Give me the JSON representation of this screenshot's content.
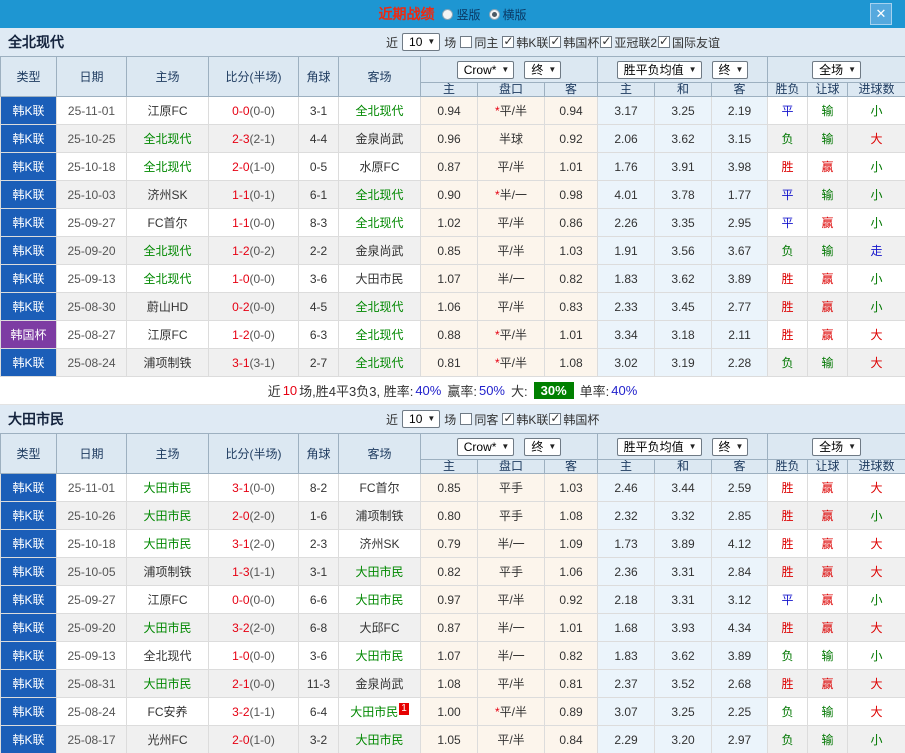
{
  "colors": {
    "topbar_blue": "#1e96d2",
    "title_red": "#ee2a11",
    "score_red": "#e60012",
    "team_green": "#008800",
    "result_blue": "#1414cc",
    "type_blue": "#1b5eb8",
    "type_purple": "#7d3ca3",
    "big_rate_bg": "#008000",
    "odds_cell_bg": "#fcf5ec",
    "avg_cell_bg": "#ebf4fb",
    "section_bar_bg": "#dfeaf4",
    "header_bg": "#dce8f2"
  },
  "topbar": {
    "title": "近期战绩",
    "layout_options": [
      {
        "label": "竖版",
        "selected": false
      },
      {
        "label": "横版",
        "selected": true
      }
    ],
    "close_label": "✕"
  },
  "table_header": {
    "type": "类型",
    "date": "日期",
    "home": "主场",
    "score": "比分(半场)",
    "corner": "角球",
    "away": "客场",
    "odds_select": "Crow*",
    "odds_final_select": "终",
    "avg_select": "胜平负均值",
    "avg_final_select": "终",
    "scope_select": "全场",
    "sub": [
      "主",
      "盘口",
      "客",
      "主",
      "和",
      "客",
      "胜负",
      "让球",
      "进球数"
    ]
  },
  "sections": [
    {
      "team": "全北现代",
      "filters": {
        "near": "近",
        "count": "10",
        "games": "场",
        "same": {
          "label": "同主",
          "checked": false
        },
        "leagues": [
          {
            "label": "韩K联",
            "checked": true
          },
          {
            "label": "韩国杯",
            "checked": true
          },
          {
            "label": "亚冠联2",
            "checked": true
          },
          {
            "label": "国际友谊",
            "checked": true
          }
        ]
      },
      "rows": [
        {
          "type": "韩K联",
          "cup": false,
          "date": "25-11-01",
          "home": "江原FC",
          "homeSelf": false,
          "score": "0-0",
          "half": "(0-0)",
          "corner": "3-1",
          "away": "全北现代",
          "awaySelf": true,
          "badge": "",
          "star": true,
          "homeOdds": "0.94",
          "handicap": "平/半",
          "awayOdds": "0.94",
          "avgWin": "3.17",
          "avgDraw": "3.25",
          "avgLose": "2.19",
          "result": "平",
          "resultColor": "blue",
          "letResult": "输",
          "letColor": "green",
          "goalResult": "小",
          "goalColor": "green"
        },
        {
          "type": "韩K联",
          "cup": false,
          "date": "25-10-25",
          "home": "全北现代",
          "homeSelf": true,
          "score": "2-3",
          "half": "(2-1)",
          "corner": "4-4",
          "away": "金泉尚武",
          "awaySelf": false,
          "badge": "",
          "star": false,
          "homeOdds": "0.96",
          "handicap": "半球",
          "awayOdds": "0.92",
          "avgWin": "2.06",
          "avgDraw": "3.62",
          "avgLose": "3.15",
          "result": "负",
          "resultColor": "green",
          "letResult": "输",
          "letColor": "green",
          "goalResult": "大",
          "goalColor": "red"
        },
        {
          "type": "韩K联",
          "cup": false,
          "date": "25-10-18",
          "home": "全北现代",
          "homeSelf": true,
          "score": "2-0",
          "half": "(1-0)",
          "corner": "0-5",
          "away": "水原FC",
          "awaySelf": false,
          "badge": "",
          "star": false,
          "homeOdds": "0.87",
          "handicap": "平/半",
          "awayOdds": "1.01",
          "avgWin": "1.76",
          "avgDraw": "3.91",
          "avgLose": "3.98",
          "result": "胜",
          "resultColor": "red",
          "letResult": "赢",
          "letColor": "red",
          "goalResult": "小",
          "goalColor": "green"
        },
        {
          "type": "韩K联",
          "cup": false,
          "date": "25-10-03",
          "home": "济州SK",
          "homeSelf": false,
          "score": "1-1",
          "half": "(0-1)",
          "corner": "6-1",
          "away": "全北现代",
          "awaySelf": true,
          "badge": "",
          "star": true,
          "homeOdds": "0.90",
          "handicap": "半/一",
          "awayOdds": "0.98",
          "avgWin": "4.01",
          "avgDraw": "3.78",
          "avgLose": "1.77",
          "result": "平",
          "resultColor": "blue",
          "letResult": "输",
          "letColor": "green",
          "goalResult": "小",
          "goalColor": "green"
        },
        {
          "type": "韩K联",
          "cup": false,
          "date": "25-09-27",
          "home": "FC首尔",
          "homeSelf": false,
          "score": "1-1",
          "half": "(0-0)",
          "corner": "8-3",
          "away": "全北现代",
          "awaySelf": true,
          "badge": "",
          "star": false,
          "homeOdds": "1.02",
          "handicap": "平/半",
          "awayOdds": "0.86",
          "avgWin": "2.26",
          "avgDraw": "3.35",
          "avgLose": "2.95",
          "result": "平",
          "resultColor": "blue",
          "letResult": "赢",
          "letColor": "red",
          "goalResult": "小",
          "goalColor": "green"
        },
        {
          "type": "韩K联",
          "cup": false,
          "date": "25-09-20",
          "home": "全北现代",
          "homeSelf": true,
          "score": "1-2",
          "half": "(0-2)",
          "corner": "2-2",
          "away": "金泉尚武",
          "awaySelf": false,
          "badge": "",
          "star": false,
          "homeOdds": "0.85",
          "handicap": "平/半",
          "awayOdds": "1.03",
          "avgWin": "1.91",
          "avgDraw": "3.56",
          "avgLose": "3.67",
          "result": "负",
          "resultColor": "green",
          "letResult": "输",
          "letColor": "green",
          "goalResult": "走",
          "goalColor": "blue"
        },
        {
          "type": "韩K联",
          "cup": false,
          "date": "25-09-13",
          "home": "全北现代",
          "homeSelf": true,
          "score": "1-0",
          "half": "(0-0)",
          "corner": "3-6",
          "away": "大田市民",
          "awaySelf": false,
          "badge": "",
          "star": false,
          "homeOdds": "1.07",
          "handicap": "半/一",
          "awayOdds": "0.82",
          "avgWin": "1.83",
          "avgDraw": "3.62",
          "avgLose": "3.89",
          "result": "胜",
          "resultColor": "red",
          "letResult": "赢",
          "letColor": "red",
          "goalResult": "小",
          "goalColor": "green"
        },
        {
          "type": "韩K联",
          "cup": false,
          "date": "25-08-30",
          "home": "蔚山HD",
          "homeSelf": false,
          "score": "0-2",
          "half": "(0-0)",
          "corner": "4-5",
          "away": "全北现代",
          "awaySelf": true,
          "badge": "",
          "star": false,
          "homeOdds": "1.06",
          "handicap": "平/半",
          "awayOdds": "0.83",
          "avgWin": "2.33",
          "avgDraw": "3.45",
          "avgLose": "2.77",
          "result": "胜",
          "resultColor": "red",
          "letResult": "赢",
          "letColor": "red",
          "goalResult": "小",
          "goalColor": "green"
        },
        {
          "type": "韩国杯",
          "cup": true,
          "date": "25-08-27",
          "home": "江原FC",
          "homeSelf": false,
          "score": "1-2",
          "half": "(0-0)",
          "corner": "6-3",
          "away": "全北现代",
          "awaySelf": true,
          "badge": "",
          "star": true,
          "homeOdds": "0.88",
          "handicap": "平/半",
          "awayOdds": "1.01",
          "avgWin": "3.34",
          "avgDraw": "3.18",
          "avgLose": "2.11",
          "result": "胜",
          "resultColor": "red",
          "letResult": "赢",
          "letColor": "red",
          "goalResult": "大",
          "goalColor": "red"
        },
        {
          "type": "韩K联",
          "cup": false,
          "date": "25-08-24",
          "home": "浦项制铁",
          "homeSelf": false,
          "score": "3-1",
          "half": "(3-1)",
          "corner": "2-7",
          "away": "全北现代",
          "awaySelf": true,
          "badge": "",
          "star": true,
          "homeOdds": "0.81",
          "handicap": "平/半",
          "awayOdds": "1.08",
          "avgWin": "3.02",
          "avgDraw": "3.19",
          "avgLose": "2.28",
          "result": "负",
          "resultColor": "green",
          "letResult": "输",
          "letColor": "green",
          "goalResult": "大",
          "goalColor": "red"
        }
      ],
      "summary": {
        "prefix": "近",
        "count": "10",
        "seg1": "场,胜4平3负3, 胜率:",
        "rate1": "40%",
        "seg2": "赢率:",
        "rate2": "50%",
        "seg3": "大:",
        "big_rate": "30%",
        "seg4": "单率:",
        "rate3": "40%"
      }
    },
    {
      "team": "大田市民",
      "filters": {
        "near": "近",
        "count": "10",
        "games": "场",
        "same": {
          "label": "同客",
          "checked": false
        },
        "leagues": [
          {
            "label": "韩K联",
            "checked": true
          },
          {
            "label": "韩国杯",
            "checked": true
          }
        ]
      },
      "rows": [
        {
          "type": "韩K联",
          "cup": false,
          "date": "25-11-01",
          "home": "大田市民",
          "homeSelf": true,
          "score": "3-1",
          "half": "(0-0)",
          "corner": "8-2",
          "away": "FC首尔",
          "awaySelf": false,
          "badge": "",
          "star": false,
          "homeOdds": "0.85",
          "handicap": "平手",
          "awayOdds": "1.03",
          "avgWin": "2.46",
          "avgDraw": "3.44",
          "avgLose": "2.59",
          "result": "胜",
          "resultColor": "red",
          "letResult": "赢",
          "letColor": "red",
          "goalResult": "大",
          "goalColor": "red"
        },
        {
          "type": "韩K联",
          "cup": false,
          "date": "25-10-26",
          "home": "大田市民",
          "homeSelf": true,
          "score": "2-0",
          "half": "(2-0)",
          "corner": "1-6",
          "away": "浦项制铁",
          "awaySelf": false,
          "badge": "",
          "star": false,
          "homeOdds": "0.80",
          "handicap": "平手",
          "awayOdds": "1.08",
          "avgWin": "2.32",
          "avgDraw": "3.32",
          "avgLose": "2.85",
          "result": "胜",
          "resultColor": "red",
          "letResult": "赢",
          "letColor": "red",
          "goalResult": "小",
          "goalColor": "green"
        },
        {
          "type": "韩K联",
          "cup": false,
          "date": "25-10-18",
          "home": "大田市民",
          "homeSelf": true,
          "score": "3-1",
          "half": "(2-0)",
          "corner": "2-3",
          "away": "济州SK",
          "awaySelf": false,
          "badge": "",
          "star": false,
          "homeOdds": "0.79",
          "handicap": "半/一",
          "awayOdds": "1.09",
          "avgWin": "1.73",
          "avgDraw": "3.89",
          "avgLose": "4.12",
          "result": "胜",
          "resultColor": "red",
          "letResult": "赢",
          "letColor": "red",
          "goalResult": "大",
          "goalColor": "red"
        },
        {
          "type": "韩K联",
          "cup": false,
          "date": "25-10-05",
          "home": "浦项制铁",
          "homeSelf": false,
          "score": "1-3",
          "half": "(1-1)",
          "corner": "3-1",
          "away": "大田市民",
          "awaySelf": true,
          "badge": "",
          "star": false,
          "homeOdds": "0.82",
          "handicap": "平手",
          "awayOdds": "1.06",
          "avgWin": "2.36",
          "avgDraw": "3.31",
          "avgLose": "2.84",
          "result": "胜",
          "resultColor": "red",
          "letResult": "赢",
          "letColor": "red",
          "goalResult": "大",
          "goalColor": "red"
        },
        {
          "type": "韩K联",
          "cup": false,
          "date": "25-09-27",
          "home": "江原FC",
          "homeSelf": false,
          "score": "0-0",
          "half": "(0-0)",
          "corner": "6-6",
          "away": "大田市民",
          "awaySelf": true,
          "badge": "",
          "star": false,
          "homeOdds": "0.97",
          "handicap": "平/半",
          "awayOdds": "0.92",
          "avgWin": "2.18",
          "avgDraw": "3.31",
          "avgLose": "3.12",
          "result": "平",
          "resultColor": "blue",
          "letResult": "赢",
          "letColor": "red",
          "goalResult": "小",
          "goalColor": "green"
        },
        {
          "type": "韩K联",
          "cup": false,
          "date": "25-09-20",
          "home": "大田市民",
          "homeSelf": true,
          "score": "3-2",
          "half": "(2-0)",
          "corner": "6-8",
          "away": "大邱FC",
          "awaySelf": false,
          "badge": "",
          "star": false,
          "homeOdds": "0.87",
          "handicap": "半/一",
          "awayOdds": "1.01",
          "avgWin": "1.68",
          "avgDraw": "3.93",
          "avgLose": "4.34",
          "result": "胜",
          "resultColor": "red",
          "letResult": "赢",
          "letColor": "red",
          "goalResult": "大",
          "goalColor": "red"
        },
        {
          "type": "韩K联",
          "cup": false,
          "date": "25-09-13",
          "home": "全北现代",
          "homeSelf": false,
          "score": "1-0",
          "half": "(0-0)",
          "corner": "3-6",
          "away": "大田市民",
          "awaySelf": true,
          "badge": "",
          "star": false,
          "homeOdds": "1.07",
          "handicap": "半/一",
          "awayOdds": "0.82",
          "avgWin": "1.83",
          "avgDraw": "3.62",
          "avgLose": "3.89",
          "result": "负",
          "resultColor": "green",
          "letResult": "输",
          "letColor": "green",
          "goalResult": "小",
          "goalColor": "green"
        },
        {
          "type": "韩K联",
          "cup": false,
          "date": "25-08-31",
          "home": "大田市民",
          "homeSelf": true,
          "score": "2-1",
          "half": "(0-0)",
          "corner": "11-3",
          "away": "金泉尚武",
          "awaySelf": false,
          "badge": "",
          "star": false,
          "homeOdds": "1.08",
          "handicap": "平/半",
          "awayOdds": "0.81",
          "avgWin": "2.37",
          "avgDraw": "3.52",
          "avgLose": "2.68",
          "result": "胜",
          "resultColor": "red",
          "letResult": "赢",
          "letColor": "red",
          "goalResult": "大",
          "goalColor": "red"
        },
        {
          "type": "韩K联",
          "cup": false,
          "date": "25-08-24",
          "home": "FC安养",
          "homeSelf": false,
          "score": "3-2",
          "half": "(1-1)",
          "corner": "6-4",
          "away": "大田市民",
          "awaySelf": true,
          "badge": "1",
          "star": true,
          "homeOdds": "1.00",
          "handicap": "平/半",
          "awayOdds": "0.89",
          "avgWin": "3.07",
          "avgDraw": "3.25",
          "avgLose": "2.25",
          "result": "负",
          "resultColor": "green",
          "letResult": "输",
          "letColor": "green",
          "goalResult": "大",
          "goalColor": "red"
        },
        {
          "type": "韩K联",
          "cup": false,
          "date": "25-08-17",
          "home": "光州FC",
          "homeSelf": false,
          "score": "2-0",
          "half": "(1-0)",
          "corner": "3-2",
          "away": "大田市民",
          "awaySelf": true,
          "badge": "",
          "star": false,
          "homeOdds": "1.05",
          "handicap": "平/半",
          "awayOdds": "0.84",
          "avgWin": "2.29",
          "avgDraw": "3.20",
          "avgLose": "2.97",
          "result": "负",
          "resultColor": "green",
          "letResult": "输",
          "letColor": "green",
          "goalResult": "小",
          "goalColor": "green"
        }
      ]
    }
  ]
}
